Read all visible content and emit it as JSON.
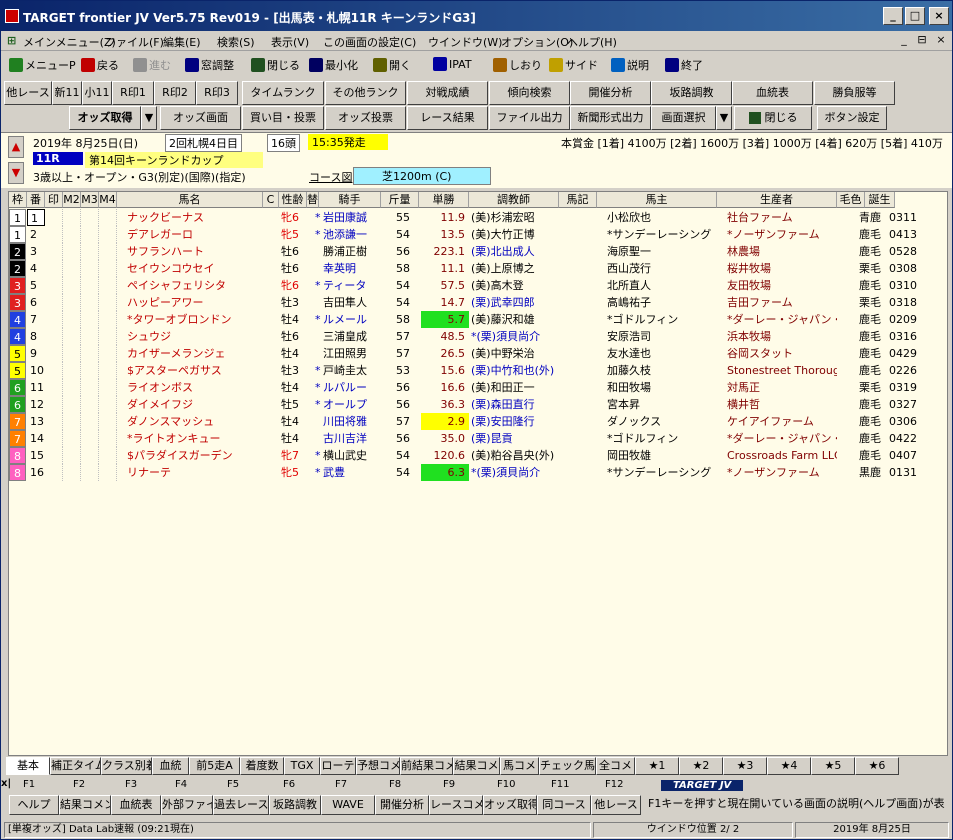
{
  "window": {
    "title": "TARGET frontier JV  Ver5.75  Rev019 - [出馬表・札幌11R キーンランドG3]",
    "min": "_",
    "max": "□",
    "close": "×",
    "mdi_min": "_",
    "mdi_restore": "⊟",
    "mdi_close": "×"
  },
  "menu": [
    "メインメニュー(Z)",
    "ファイル(F)",
    "編集(E)",
    "検索(S)",
    "表示(V)",
    "この画面の設定(C)",
    "ウインドウ(W)",
    "オプション(O)",
    "ヘルプ(H)"
  ],
  "toolbar": [
    {
      "label": "メニューP",
      "icon": "menu-icon",
      "color": "#208020"
    },
    {
      "label": "戻る",
      "icon": "back-arrow-icon",
      "color": "#c00000"
    },
    {
      "label": "進む",
      "icon": "forward-arrow-icon",
      "color": "#909090"
    },
    {
      "label": "窓調整",
      "icon": "window-adjust-icon",
      "color": "#000080"
    },
    {
      "label": "閉じる",
      "icon": "close-door-icon",
      "color": "#205020"
    },
    {
      "label": "最小化",
      "icon": "minimize-icon",
      "color": "#000060"
    },
    {
      "label": "開く",
      "icon": "open-book-icon",
      "color": "#606000"
    },
    {
      "label": "IPAT",
      "icon": "pat-icon",
      "color": "#0000a0"
    },
    {
      "label": "しおり",
      "icon": "bookmark-icon",
      "color": "#a06000"
    },
    {
      "label": "サイド",
      "icon": "side-icon",
      "color": "#c0a000"
    },
    {
      "label": "説明",
      "icon": "help-book-icon",
      "color": "#0060c0"
    },
    {
      "label": "終了",
      "icon": "moon-exit-icon",
      "color": "#000080"
    }
  ],
  "nav_row1": {
    "buttons": [
      "他レース",
      "新11",
      "小11",
      "R印1",
      "R印2",
      "R印3",
      "タイムランク",
      "その他ランク",
      "対戦成績",
      "傾向検索",
      "開催分析",
      "坂路調教",
      "血統表",
      "勝負服等"
    ]
  },
  "nav_row2": {
    "odds_label": "オッズ取得",
    "buttons": [
      "オッズ画面",
      "買い目・投票",
      "オッズ投票",
      "レース結果",
      "ファイル出力",
      "新聞形式出力",
      "画面選択"
    ],
    "close": "閉じる",
    "settings": "ボタン設定"
  },
  "race": {
    "date": "2019年 8月25日(日)",
    "meet": "2回札幌4日目",
    "heads": "16頭",
    "post_time": "15:35発走",
    "race_no": "11R",
    "race_name": "第14回キーンランドカップ",
    "conditions": "3歳以上・オープン・G3(別定)(国際)(指定)",
    "course_label": "コース図",
    "course": "芝1200m (C)",
    "prize": "本賞金 [1着] 4100万 [2着] 1600万 [3着] 1000万 [4着] 620万 [5着] 410万"
  },
  "columns": [
    "枠",
    "番",
    "印",
    "M2",
    "M3",
    "M4",
    "馬名",
    "C",
    "性齢",
    "替",
    "騎手",
    "斤量",
    "単勝",
    "調教師",
    "馬記",
    "馬主",
    "生産者",
    "毛色",
    "誕生"
  ],
  "rows": [
    {
      "waku": "1",
      "ban": "1",
      "name": "ナックビーナス",
      "sex": "牝6",
      "kae": "*",
      "jockey": "岩田康誠",
      "kin": "55",
      "odds": "11.9",
      "trainer": "(美)杉浦宏昭",
      "mk": "",
      "owner": "小松欣也",
      "breeder": "社台ファーム",
      "coat": "青鹿",
      "birth": "0311"
    },
    {
      "waku": "1",
      "ban": "2",
      "name": "デアレガーロ",
      "sex": "牝5",
      "kae": "*",
      "jockey": "池添謙一",
      "kin": "54",
      "odds": "13.5",
      "trainer": "(美)大竹正博",
      "mk": "",
      "owner": "*サンデーレーシング",
      "breeder": "*ノーザンファーム",
      "coat": "鹿毛",
      "birth": "0413"
    },
    {
      "waku": "2",
      "ban": "3",
      "name": "サフランハート",
      "sex": "牡6",
      "kae": "",
      "jockey": "勝浦正樹",
      "kin": "56",
      "odds": "223.1",
      "trainer": "(栗)北出成人",
      "mk": "",
      "owner": "海原聖一",
      "breeder": "林農場",
      "coat": "鹿毛",
      "birth": "0528"
    },
    {
      "waku": "2",
      "ban": "4",
      "name": "セイウンコウセイ",
      "sex": "牡6",
      "kae": "",
      "jockey": "幸英明",
      "kin": "58",
      "odds": "11.1",
      "trainer": "(美)上原博之",
      "mk": "",
      "owner": "西山茂行",
      "breeder": "桜井牧場",
      "coat": "栗毛",
      "birth": "0308"
    },
    {
      "waku": "3",
      "ban": "5",
      "name": "ペイシャフェリシタ",
      "sex": "牝6",
      "kae": "*",
      "jockey": "ティータ",
      "kin": "54",
      "odds": "57.5",
      "trainer": "(美)高木登",
      "mk": "",
      "owner": "北所直人",
      "breeder": "友田牧場",
      "coat": "鹿毛",
      "birth": "0310"
    },
    {
      "waku": "3",
      "ban": "6",
      "name": "ハッピーアワー",
      "sex": "牡3",
      "kae": "",
      "jockey": "吉田隼人",
      "kin": "54",
      "odds": "14.7",
      "trainer": "(栗)武幸四郎",
      "mk": "",
      "owner": "高嶋祐子",
      "breeder": "吉田ファーム",
      "coat": "栗毛",
      "birth": "0318"
    },
    {
      "waku": "4",
      "ban": "7",
      "name": "*タワーオブロンドン",
      "sex": "牡4",
      "kae": "*",
      "jockey": "ルメール",
      "kin": "58",
      "odds": "5.7",
      "trainer": "(美)藤沢和雄",
      "mk": "",
      "owner": "*ゴドルフィン",
      "breeder": "*ダーレー・ジャパン・ファ",
      "coat": "鹿毛",
      "birth": "0209"
    },
    {
      "waku": "4",
      "ban": "8",
      "name": "シュウジ",
      "sex": "牡6",
      "kae": "",
      "jockey": "三浦皇成",
      "kin": "57",
      "odds": "48.5",
      "trainer": "*(栗)須貝尚介",
      "mk": "",
      "owner": "安原浩司",
      "breeder": "浜本牧場",
      "coat": "鹿毛",
      "birth": "0316"
    },
    {
      "waku": "5",
      "ban": "9",
      "name": "カイザーメランジェ",
      "sex": "牡4",
      "kae": "",
      "jockey": "江田照男",
      "kin": "57",
      "odds": "26.5",
      "trainer": "(美)中野栄治",
      "mk": "",
      "owner": "友水達也",
      "breeder": "谷岡スタット",
      "coat": "鹿毛",
      "birth": "0429"
    },
    {
      "waku": "5",
      "ban": "10",
      "name": "$アスターペガサス",
      "sex": "牡3",
      "kae": "*",
      "jockey": "戸崎圭太",
      "kin": "53",
      "odds": "15.6",
      "trainer": "(栗)中竹和也(外)",
      "mk": "",
      "owner": "加藤久枝",
      "breeder": "Stonestreet Thorough",
      "coat": "鹿毛",
      "birth": "0226"
    },
    {
      "waku": "6",
      "ban": "11",
      "name": "ライオンボス",
      "sex": "牡4",
      "kae": "*",
      "jockey": "ルパルー",
      "kin": "56",
      "odds": "16.6",
      "trainer": "(美)和田正一",
      "mk": "",
      "owner": "和田牧場",
      "breeder": "対馬正",
      "coat": "栗毛",
      "birth": "0319"
    },
    {
      "waku": "6",
      "ban": "12",
      "name": "ダイメイフジ",
      "sex": "牡5",
      "kae": "*",
      "jockey": "オールプ",
      "kin": "56",
      "odds": "36.3",
      "trainer": "(栗)森田直行",
      "mk": "",
      "owner": "宮本昇",
      "breeder": "横井哲",
      "coat": "鹿毛",
      "birth": "0327"
    },
    {
      "waku": "7",
      "ban": "13",
      "name": "ダノンスマッシュ",
      "sex": "牡4",
      "kae": "",
      "jockey": "川田将雅",
      "kin": "57",
      "odds": "2.9",
      "trainer": "(栗)安田隆行",
      "mk": "",
      "owner": "ダノックス",
      "breeder": "ケイアイファーム",
      "coat": "鹿毛",
      "birth": "0306"
    },
    {
      "waku": "7",
      "ban": "14",
      "name": "*ライトオンキュー",
      "sex": "牡4",
      "kae": "",
      "jockey": "古川吉洋",
      "kin": "56",
      "odds": "35.0",
      "trainer": "(栗)昆貢",
      "mk": "",
      "owner": "*ゴドルフィン",
      "breeder": "*ダーレー・ジャパン・ファ",
      "coat": "鹿毛",
      "birth": "0422"
    },
    {
      "waku": "8",
      "ban": "15",
      "name": "$パラダイスガーデン",
      "sex": "牝7",
      "kae": "*",
      "jockey": "横山武史",
      "kin": "54",
      "odds": "120.6",
      "trainer": "(美)粕谷昌央(外)",
      "mk": "",
      "owner": "岡田牧雄",
      "breeder": "Crossroads Farm LLC",
      "coat": "鹿毛",
      "birth": "0407"
    },
    {
      "waku": "8",
      "ban": "16",
      "name": "リナーテ",
      "sex": "牝5",
      "kae": "*",
      "jockey": "武豊",
      "kin": "54",
      "odds": "6.3",
      "trainer": "*(栗)須貝尚介",
      "mk": "",
      "owner": "*サンデーレーシング",
      "breeder": "*ノーザンファーム",
      "coat": "黒鹿",
      "birth": "0131"
    }
  ],
  "tabs": [
    "基本",
    "補正タイム",
    "クラス別着",
    "血統",
    "前5走A",
    "着度数",
    "TGX",
    "ローテ",
    "予想コメ",
    "前結果コメ",
    "結果コメ",
    "馬コメ",
    "チェック馬コメ",
    "全コメ",
    "★1",
    "★2",
    "★3",
    "★4",
    "★5",
    "★6"
  ],
  "fkeys": {
    "keys": [
      "F1",
      "F2",
      "F3",
      "F4",
      "F5",
      "F6",
      "F7",
      "F8",
      "F9",
      "F10",
      "F11",
      "F12"
    ],
    "labels": [
      "ヘルプ",
      "結果コメント",
      "血統表",
      "外部ファイル",
      "過去レース",
      "坂路調教",
      "WAVE",
      "開催分析",
      "レースコメント",
      "オッズ取得",
      "同コース",
      "他レース"
    ],
    "brand": "TARGET JV",
    "hint": "F1キーを押すと現在開いている画面の説明(ヘルプ画面)が表"
  },
  "status": {
    "left": "[単複オッズ] Data Lab速報 (09:21現在)",
    "middle": "ウインドウ位置 2/ 2",
    "right": "2019年 8月25日"
  },
  "colors": {
    "waku": {
      "1": "#ffffff",
      "2": "#000000",
      "3": "#e02020",
      "4": "#2040e0",
      "5": "#ffff00",
      "6": "#20a020",
      "7": "#ff8000",
      "8": "#ff60c0"
    }
  }
}
